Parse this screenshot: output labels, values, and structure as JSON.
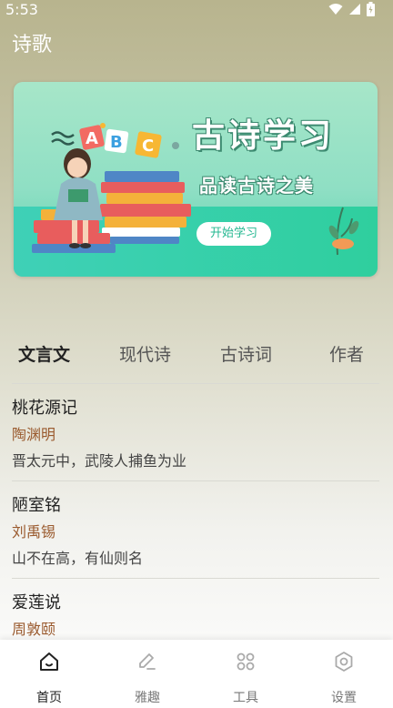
{
  "status_bar": {
    "time": "5:53"
  },
  "app": {
    "title": "诗歌"
  },
  "banner": {
    "title": "古诗学习",
    "subtitle": "品读古诗之美",
    "button_label": "开始学习",
    "colors": {
      "top": "#a7e6c9",
      "bottom": "#2fcf9e"
    }
  },
  "tabs": [
    {
      "label": "文言文",
      "active": true
    },
    {
      "label": "现代诗",
      "active": false
    },
    {
      "label": "古诗词",
      "active": false
    },
    {
      "label": "作者",
      "active": false
    }
  ],
  "poems": [
    {
      "title": "桃花源记",
      "author": "陶渊明",
      "line": "晋太元中，武陵人捕鱼为业"
    },
    {
      "title": "陋室铭",
      "author": "刘禹锡",
      "line": "山不在高，有仙则名"
    },
    {
      "title": "爱莲说",
      "author": "周敦颐",
      "line": ""
    }
  ],
  "bottom_nav": [
    {
      "label": "首页",
      "icon": "home-icon",
      "active": true
    },
    {
      "label": "雅趣",
      "icon": "edit-icon",
      "active": false
    },
    {
      "label": "工具",
      "icon": "grid-icon",
      "active": false
    },
    {
      "label": "设置",
      "icon": "settings-icon",
      "active": false
    }
  ],
  "colors": {
    "author": "#9a5a2e",
    "accent": "#26b892"
  }
}
